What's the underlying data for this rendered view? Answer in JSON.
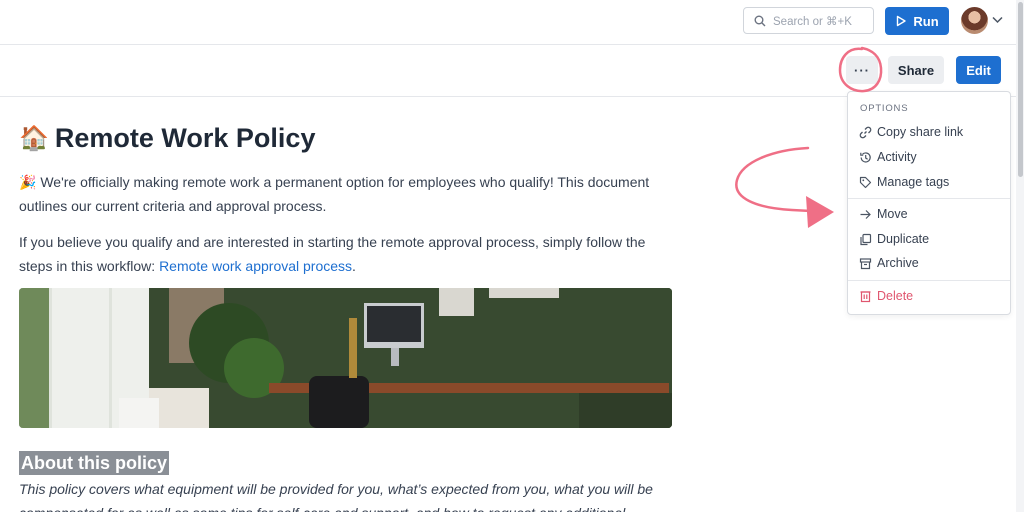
{
  "topbar": {
    "search_placeholder": "Search or ⌘+K",
    "run_label": "Run"
  },
  "toolbar": {
    "more_label": "···",
    "share_label": "Share",
    "edit_label": "Edit"
  },
  "menu": {
    "heading": "OPTIONS",
    "items": [
      {
        "label": "Copy share link",
        "icon": "link-icon"
      },
      {
        "label": "Activity",
        "icon": "history-icon"
      },
      {
        "label": "Manage tags",
        "icon": "tag-icon"
      },
      {
        "label": "Move",
        "icon": "arrow-right-icon"
      },
      {
        "label": "Duplicate",
        "icon": "copy-icon"
      },
      {
        "label": "Archive",
        "icon": "archive-icon"
      },
      {
        "label": "Delete",
        "icon": "trash-icon"
      }
    ]
  },
  "doc": {
    "title_emoji": "🏠",
    "title": "Remote Work Policy",
    "p1_emoji": "🎉",
    "p1": "We're officially making remote work a permanent option for employees who qualify! This document outlines our current criteria and approval process.",
    "p2": "If you believe you qualify and are interested in starting the remote approval process, simply follow the steps in this workflow:",
    "p2_link": "Remote work approval process",
    "p2_end": ".",
    "h2": "About this policy",
    "p3": "This policy covers what equipment will be provided for you, what’s expected from you, what you will be compensated for as well as some tips for self-care and support, and how to request any additional"
  },
  "colors": {
    "primary": "#1e6fd0",
    "danger": "#e0566f",
    "annotation": "#ef6f86"
  }
}
